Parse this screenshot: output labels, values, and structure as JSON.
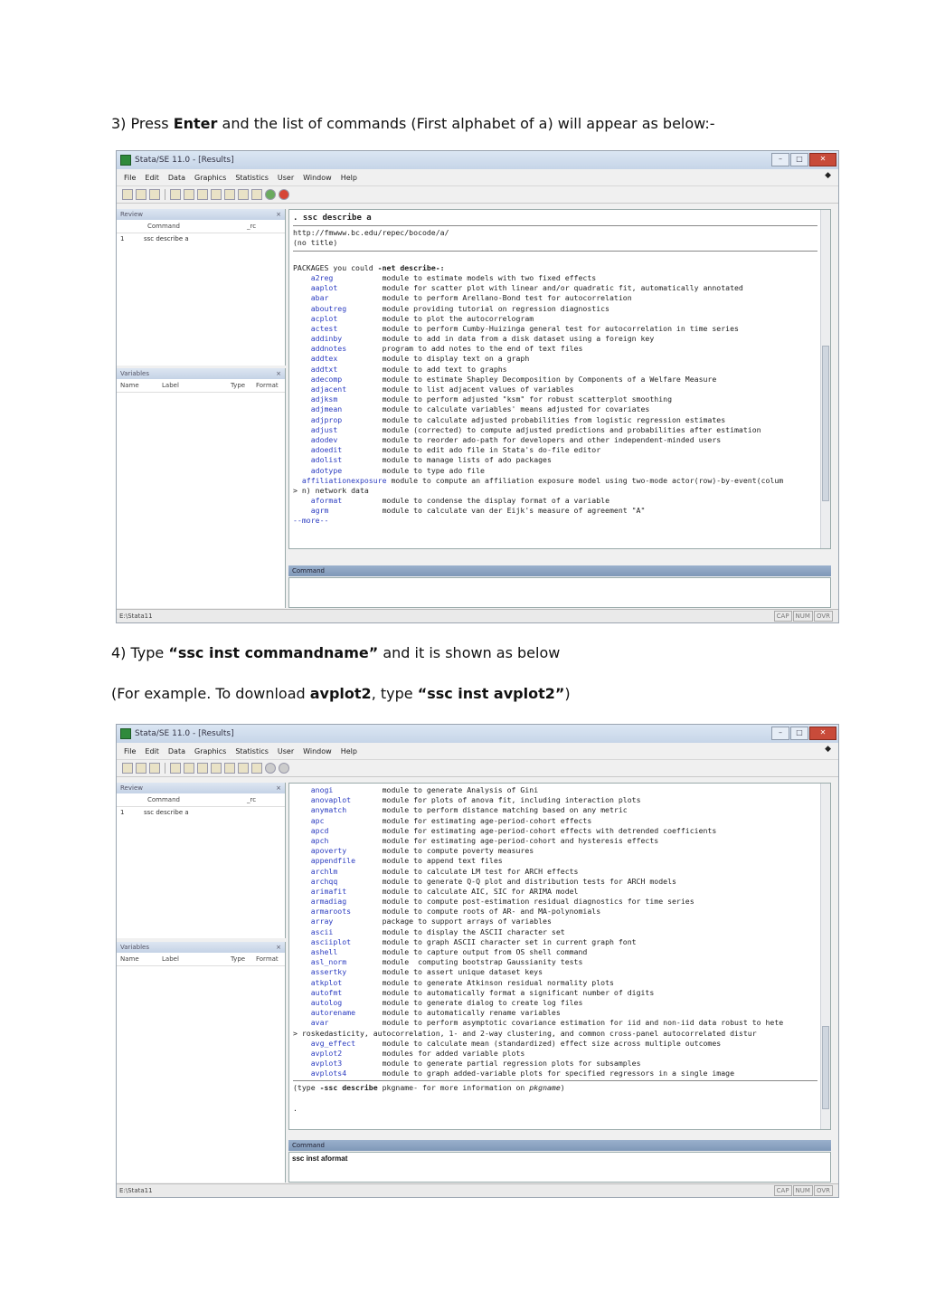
{
  "step3": {
    "prefix": "3) Press ",
    "bold": "Enter",
    "suffix": "  and the list of commands (First alphabet of a) will appear as below:-"
  },
  "step4": {
    "prefix": "4) Type ",
    "bold": "“ssc inst commandname”",
    "suffix": " and it is shown as below"
  },
  "example": {
    "prefix": "(For example. To download ",
    "bold1": "avplot2",
    "mid": ", type ",
    "bold2": "“ssc inst avplot2”",
    "suffix": ")"
  },
  "window": {
    "title": "Stata/SE 11.0 - [Results]",
    "menu": [
      "File",
      "Edit",
      "Data",
      "Graphics",
      "Statistics",
      "User",
      "Window",
      "Help"
    ],
    "review": {
      "title": "Review",
      "close": "×",
      "col_command": "Command",
      "col_rc": "_rc",
      "row_num": "1",
      "row_cmd": "ssc describe a"
    },
    "variables": {
      "title": "Variables",
      "close": "×",
      "col_name": "Name",
      "col_label": "Label",
      "col_type": "Type",
      "col_format": "Format"
    },
    "command_label": "Command",
    "status_path": "E:\\Stata11",
    "indicators": [
      "CAP",
      "NUM",
      "OVR"
    ]
  },
  "screenshot1": {
    "header_cmd": ". ssc describe a",
    "url": "http://fmwww.bc.edu/repec/bocode/a/",
    "notitle": "(no title)",
    "packages_label": "PACKAGES you could ",
    "net_describe": "-net describe-:",
    "entries": [
      {
        "name": "a2reg",
        "desc": "module to estimate models with two fixed effects"
      },
      {
        "name": "aaplot",
        "desc": "module for scatter plot with linear and/or quadratic fit, automatically annotated"
      },
      {
        "name": "abar",
        "desc": "module to perform Arellano-Bond test for autocorrelation"
      },
      {
        "name": "aboutreg",
        "desc": "module providing tutorial on regression diagnostics"
      },
      {
        "name": "acplot",
        "desc": "module to plot the autocorrelogram"
      },
      {
        "name": "actest",
        "desc": "module to perform Cumby-Huizinga general test for autocorrelation in time series"
      },
      {
        "name": "addinby",
        "desc": "module to add in data from a disk dataset using a foreign key"
      },
      {
        "name": "addnotes",
        "desc": "program to add notes to the end of text files"
      },
      {
        "name": "addtex",
        "desc": "module to display text on a graph"
      },
      {
        "name": "addtxt",
        "desc": "module to add text to graphs"
      },
      {
        "name": "adecomp",
        "desc": "module to estimate Shapley Decomposition by Components of a Welfare Measure"
      },
      {
        "name": "adjacent",
        "desc": "module to list adjacent values of variables"
      },
      {
        "name": "adjksm",
        "desc": "module to perform adjusted \"ksm\" for robust scatterplot smoothing"
      },
      {
        "name": "adjmean",
        "desc": "module to calculate variables' means adjusted for covariates"
      },
      {
        "name": "adjprop",
        "desc": "module to calculate adjusted probabilities from logistic regression estimates"
      },
      {
        "name": "adjust",
        "desc": "module (corrected) to compute adjusted predictions and probabilities after estimation"
      },
      {
        "name": "adodev",
        "desc": "module to reorder ado-path for developers and other independent-minded users"
      },
      {
        "name": "adoedit",
        "desc": "module to edit ado file in Stata's do-file editor"
      },
      {
        "name": "adolist",
        "desc": "module to manage lists of ado packages"
      },
      {
        "name": "adotype",
        "desc": "module to type ado file"
      }
    ],
    "affil": "affiliationexposure",
    "affil_desc": " module to compute an affiliation exposure model using two-mode actor(row)-by-event(colum",
    "wrap": "> n) network data",
    "entries2": [
      {
        "name": "aformat",
        "desc": "module to condense the display format of a variable"
      },
      {
        "name": "agrm",
        "desc": "module to calculate van der Eijk's measure of agreement \"A\""
      }
    ],
    "more": "--more--"
  },
  "screenshot2": {
    "entries": [
      {
        "name": "anogi",
        "desc": "module to generate Analysis of Gini"
      },
      {
        "name": "anovaplot",
        "desc": "module for plots of anova fit, including interaction plots"
      },
      {
        "name": "anymatch",
        "desc": "module to perform distance matching based on any metric"
      },
      {
        "name": "apc",
        "desc": "module for estimating age-period-cohort effects"
      },
      {
        "name": "apcd",
        "desc": "module for estimating age-period-cohort effects with detrended coefficients"
      },
      {
        "name": "apch",
        "desc": "module for estimating age-period-cohort and hysteresis effects"
      },
      {
        "name": "apoverty",
        "desc": "module to compute poverty measures"
      },
      {
        "name": "appendfile",
        "desc": "module to append text files"
      },
      {
        "name": "archlm",
        "desc": "module to calculate LM test for ARCH effects"
      },
      {
        "name": "archqq",
        "desc": "module to generate Q-Q plot and distribution tests for ARCH models"
      },
      {
        "name": "arimafit",
        "desc": "module to calculate AIC, SIC for ARIMA model"
      },
      {
        "name": "armadiag",
        "desc": "module to compute post-estimation residual diagnostics for time series"
      },
      {
        "name": "armaroots",
        "desc": "module to compute roots of AR- and MA-polynomials"
      },
      {
        "name": "array",
        "desc": "package to support arrays of variables"
      },
      {
        "name": "ascii",
        "desc": "module to display the ASCII character set"
      },
      {
        "name": "asciiplot",
        "desc": "module to graph ASCII character set in current graph font"
      },
      {
        "name": "ashell",
        "desc": "module to capture output from OS shell command"
      },
      {
        "name": "asl_norm",
        "desc": "module  computing bootstrap Gaussianity tests"
      },
      {
        "name": "assertky",
        "desc": "module to assert unique dataset keys"
      },
      {
        "name": "atkplot",
        "desc": "module to generate Atkinson residual normality plots"
      },
      {
        "name": "autofmt",
        "desc": "module to automatically format a significant number of digits"
      },
      {
        "name": "autolog",
        "desc": "module to generate dialog to create log files"
      },
      {
        "name": "autorename",
        "desc": "module to automatically rename variables"
      },
      {
        "name": "avar",
        "desc": "module to perform asymptotic covariance estimation for iid and non-iid data robust to hete"
      }
    ],
    "wrap": "> roskedasticity, autocorrelation, 1- and 2-way clustering, and common cross-panel autocorrelated distur",
    "entries2": [
      {
        "name": "avg_effect",
        "desc": "module to calculate mean (standardized) effect size across multiple outcomes"
      },
      {
        "name": "avplot2",
        "desc": "modules for added variable plots"
      },
      {
        "name": "avplot3",
        "desc": "module to generate partial regression plots for subsamples"
      },
      {
        "name": "avplots4",
        "desc": "module to graph added-variable plots for specified regressors in a single image"
      }
    ],
    "footer_pre": "(type ",
    "footer_cmd": "-ssc describe",
    "footer_mid": " pkgname- for more information on ",
    "footer_pkg": "pkgname",
    "footer_end": ")",
    "prompt": ".",
    "typed_command": "ssc inst aformat"
  },
  "colors": {
    "link": "#2b3cc0",
    "titlebar": "#c6d5e8",
    "cmdbar": "#7f98b8"
  }
}
